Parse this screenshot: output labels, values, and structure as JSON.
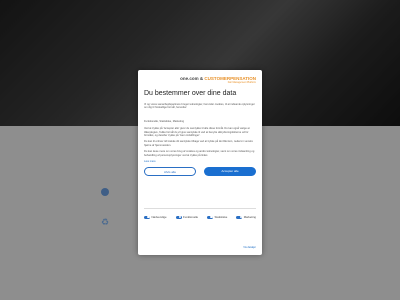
{
  "modal": {
    "brand_a": "one.com",
    "brand_amp": " & ",
    "brand_b": "CUSTOMERPENSATION",
    "brand_tagline": "Fair Management Platform",
    "title": "Du bestemmer over dine data",
    "intro": "Vi og vores samarbejdspartnere bruger teknologier, herunder cookies, til at indsamle oplysninger om dig til forskellige formål, herunder:",
    "categories": "Funktionelle, Statistiske, Marketing",
    "para1": "Ved at trykke på 'Accepter alle' giver du samtykke til alle disse formål. Du kan også vælge at tilkendegive, hvilke formål du vil give samtykke til ved at benytte afkrydsningsfelterne ud for formålet, og derefter trykke på 'Gem indstillinger'.",
    "para2": "Du kan til enhver tid trække dit samtykke tilbage ved at trykke på det lille ikon, nederst i venstre hjørne af hjemmesiden.",
    "para3": "Du kan læse mere om vores brug af cookies og andre teknologier, samt om vores indsamling og behandling af personoplysninger ved at trykke på linket.",
    "read_more": "Læs mere",
    "reject_label": "Afvis alle",
    "accept_label": "Accepter alle",
    "toggles": [
      "Nødvendige",
      "Funktionelle",
      "Statistiske",
      "Marketing"
    ],
    "details_link": "Vis detaljer"
  },
  "colors": {
    "accent": "#1a6fd0",
    "brand_orange": "#e8922b"
  }
}
